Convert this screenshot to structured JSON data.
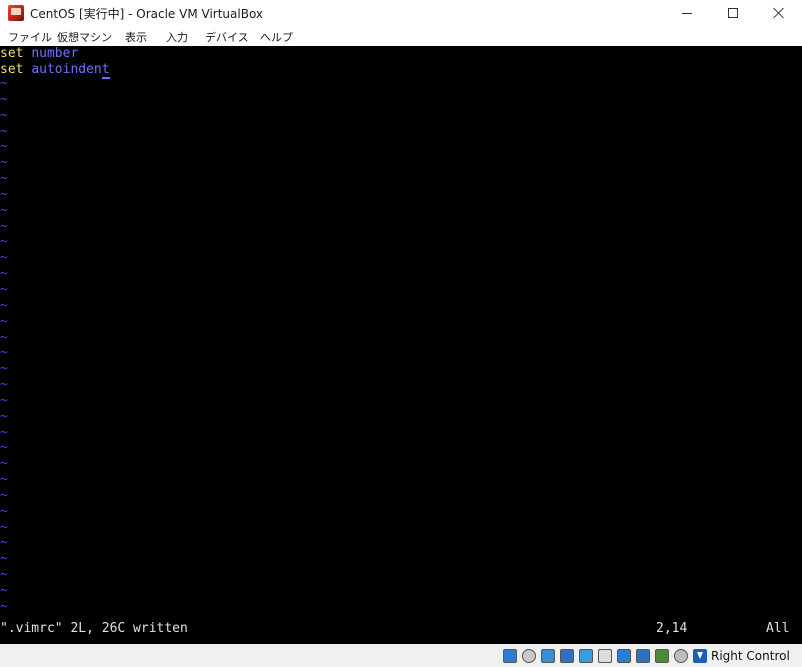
{
  "window": {
    "title": "CentOS [実行中] - Oracle VM VirtualBox"
  },
  "menu": {
    "items": [
      "ファイル",
      "仮想マシン",
      "表示",
      "入力",
      "デバイス",
      "ヘルプ"
    ]
  },
  "editor": {
    "lines": [
      {
        "keyword": "set",
        "value": "number"
      },
      {
        "keyword": "set",
        "value": "autoindent"
      }
    ],
    "tilde": "~",
    "status_message": "\".vimrc\" 2L, 26C written",
    "cursor_position": "2,14",
    "scroll_position": "All"
  },
  "statusbar": {
    "icons": [
      "hard-disk-icon",
      "optical-drive-icon",
      "audio-icon",
      "network-icon",
      "usb-icon",
      "shared-folder-icon",
      "display-icon",
      "recording-icon",
      "virtualization-icon",
      "mouse-integration-icon",
      "host-key-icon"
    ],
    "host_key_label": "Right Control"
  },
  "colors": {
    "keyword": "#f0e060",
    "value": "#7070ff",
    "tilde": "#4040ff",
    "terminal_bg": "#000000"
  }
}
